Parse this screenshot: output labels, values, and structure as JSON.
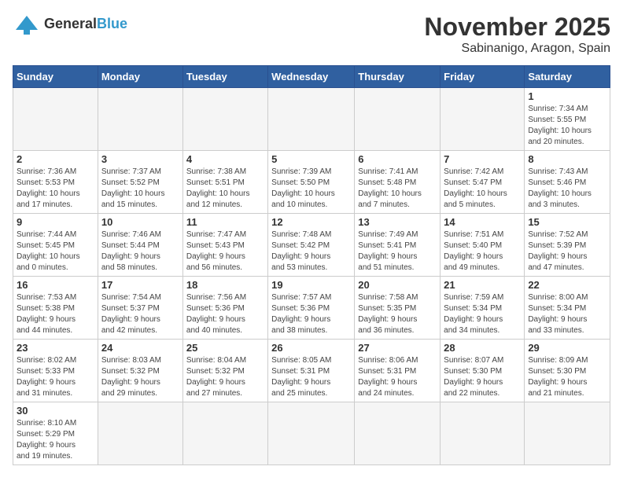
{
  "header": {
    "logo_general": "General",
    "logo_blue": "Blue",
    "title": "November 2025",
    "subtitle": "Sabinanigo, Aragon, Spain"
  },
  "weekdays": [
    "Sunday",
    "Monday",
    "Tuesday",
    "Wednesday",
    "Thursday",
    "Friday",
    "Saturday"
  ],
  "days": {
    "d1": {
      "num": "1",
      "sunrise": "7:34 AM",
      "sunset": "5:55 PM",
      "daylight_h": "10",
      "daylight_m": "20"
    },
    "d2": {
      "num": "2",
      "sunrise": "7:36 AM",
      "sunset": "5:53 PM",
      "daylight_h": "10",
      "daylight_m": "17"
    },
    "d3": {
      "num": "3",
      "sunrise": "7:37 AM",
      "sunset": "5:52 PM",
      "daylight_h": "10",
      "daylight_m": "15"
    },
    "d4": {
      "num": "4",
      "sunrise": "7:38 AM",
      "sunset": "5:51 PM",
      "daylight_h": "10",
      "daylight_m": "12"
    },
    "d5": {
      "num": "5",
      "sunrise": "7:39 AM",
      "sunset": "5:50 PM",
      "daylight_h": "10",
      "daylight_m": "10"
    },
    "d6": {
      "num": "6",
      "sunrise": "7:41 AM",
      "sunset": "5:48 PM",
      "daylight_h": "10",
      "daylight_m": "7"
    },
    "d7": {
      "num": "7",
      "sunrise": "7:42 AM",
      "sunset": "5:47 PM",
      "daylight_h": "10",
      "daylight_m": "5"
    },
    "d8": {
      "num": "8",
      "sunrise": "7:43 AM",
      "sunset": "5:46 PM",
      "daylight_h": "10",
      "daylight_m": "3"
    },
    "d9": {
      "num": "9",
      "sunrise": "7:44 AM",
      "sunset": "5:45 PM",
      "daylight_h": "10",
      "daylight_m": "0"
    },
    "d10": {
      "num": "10",
      "sunrise": "7:46 AM",
      "sunset": "5:44 PM",
      "daylight_h": "9",
      "daylight_m": "58"
    },
    "d11": {
      "num": "11",
      "sunrise": "7:47 AM",
      "sunset": "5:43 PM",
      "daylight_h": "9",
      "daylight_m": "56"
    },
    "d12": {
      "num": "12",
      "sunrise": "7:48 AM",
      "sunset": "5:42 PM",
      "daylight_h": "9",
      "daylight_m": "53"
    },
    "d13": {
      "num": "13",
      "sunrise": "7:49 AM",
      "sunset": "5:41 PM",
      "daylight_h": "9",
      "daylight_m": "51"
    },
    "d14": {
      "num": "14",
      "sunrise": "7:51 AM",
      "sunset": "5:40 PM",
      "daylight_h": "9",
      "daylight_m": "49"
    },
    "d15": {
      "num": "15",
      "sunrise": "7:52 AM",
      "sunset": "5:39 PM",
      "daylight_h": "9",
      "daylight_m": "47"
    },
    "d16": {
      "num": "16",
      "sunrise": "7:53 AM",
      "sunset": "5:38 PM",
      "daylight_h": "9",
      "daylight_m": "44"
    },
    "d17": {
      "num": "17",
      "sunrise": "7:54 AM",
      "sunset": "5:37 PM",
      "daylight_h": "9",
      "daylight_m": "42"
    },
    "d18": {
      "num": "18",
      "sunrise": "7:56 AM",
      "sunset": "5:36 PM",
      "daylight_h": "9",
      "daylight_m": "40"
    },
    "d19": {
      "num": "19",
      "sunrise": "7:57 AM",
      "sunset": "5:36 PM",
      "daylight_h": "9",
      "daylight_m": "38"
    },
    "d20": {
      "num": "20",
      "sunrise": "7:58 AM",
      "sunset": "5:35 PM",
      "daylight_h": "9",
      "daylight_m": "36"
    },
    "d21": {
      "num": "21",
      "sunrise": "7:59 AM",
      "sunset": "5:34 PM",
      "daylight_h": "9",
      "daylight_m": "34"
    },
    "d22": {
      "num": "22",
      "sunrise": "8:00 AM",
      "sunset": "5:34 PM",
      "daylight_h": "9",
      "daylight_m": "33"
    },
    "d23": {
      "num": "23",
      "sunrise": "8:02 AM",
      "sunset": "5:33 PM",
      "daylight_h": "9",
      "daylight_m": "31"
    },
    "d24": {
      "num": "24",
      "sunrise": "8:03 AM",
      "sunset": "5:32 PM",
      "daylight_h": "9",
      "daylight_m": "29"
    },
    "d25": {
      "num": "25",
      "sunrise": "8:04 AM",
      "sunset": "5:32 PM",
      "daylight_h": "9",
      "daylight_m": "27"
    },
    "d26": {
      "num": "26",
      "sunrise": "8:05 AM",
      "sunset": "5:31 PM",
      "daylight_h": "9",
      "daylight_m": "25"
    },
    "d27": {
      "num": "27",
      "sunrise": "8:06 AM",
      "sunset": "5:31 PM",
      "daylight_h": "9",
      "daylight_m": "24"
    },
    "d28": {
      "num": "28",
      "sunrise": "8:07 AM",
      "sunset": "5:30 PM",
      "daylight_h": "9",
      "daylight_m": "22"
    },
    "d29": {
      "num": "29",
      "sunrise": "8:09 AM",
      "sunset": "5:30 PM",
      "daylight_h": "9",
      "daylight_m": "21"
    },
    "d30": {
      "num": "30",
      "sunrise": "8:10 AM",
      "sunset": "5:29 PM",
      "daylight_h": "9",
      "daylight_m": "19"
    }
  }
}
